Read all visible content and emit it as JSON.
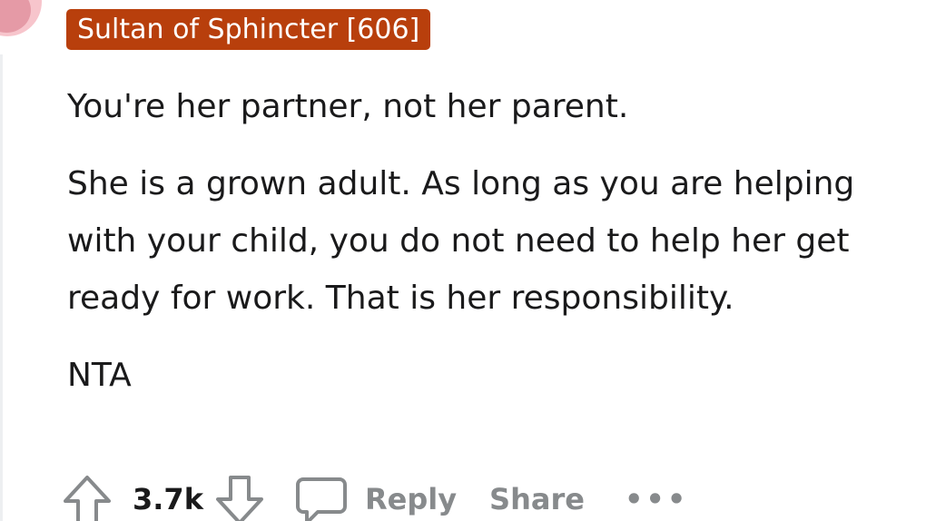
{
  "comment": {
    "flair": "Sultan of Sphincter [606]",
    "paragraphs": [
      "You're her partner, not her parent.",
      "She is a grown adult. As long as you are helping with your child, you do not need to help her get ready for work. That is her responsibility.",
      "NTA"
    ],
    "score": "3.7k",
    "reply_label": "Reply",
    "share_label": "Share",
    "more_label": "•••"
  },
  "colors": {
    "flair_bg": "#b83f0c",
    "flair_text": "#ffffff",
    "body_text": "#1a1a1b",
    "muted_text": "#878a8c",
    "avatar": "#f7c5cc"
  },
  "icons": [
    "upvote-icon",
    "downvote-icon",
    "comment-bubble-icon"
  ]
}
